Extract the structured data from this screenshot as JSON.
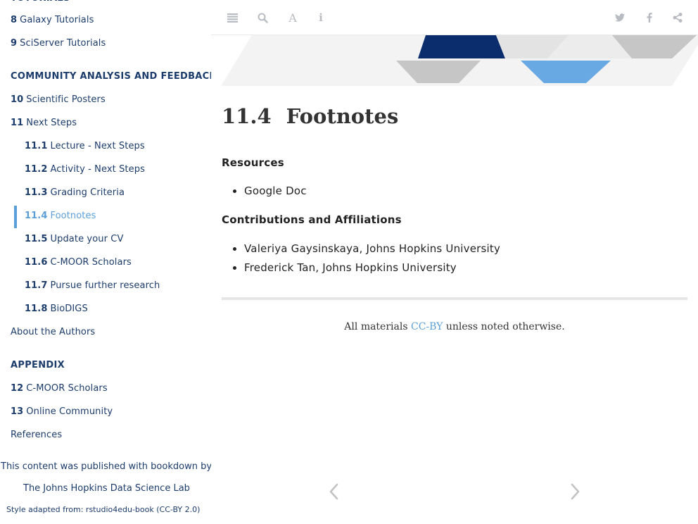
{
  "sidebar": {
    "top_partial_header": "TUTORIALS",
    "items_top": [
      {
        "num": "8",
        "label": "Galaxy Tutorials"
      },
      {
        "num": "9",
        "label": "SciServer Tutorials"
      }
    ],
    "section_community": "COMMUNITY ANALYSIS AND FEEDBACK",
    "items_community": [
      {
        "num": "10",
        "label": "Scientific Posters"
      },
      {
        "num": "11",
        "label": "Next Steps"
      }
    ],
    "subitems": [
      {
        "num": "11.1",
        "label": "Lecture - Next Steps"
      },
      {
        "num": "11.2",
        "label": "Activity - Next Steps"
      },
      {
        "num": "11.3",
        "label": "Grading Criteria"
      },
      {
        "num": "11.4",
        "label": "Footnotes"
      },
      {
        "num": "11.5",
        "label": "Update your CV"
      },
      {
        "num": "11.6",
        "label": "C-MOOR Scholars"
      },
      {
        "num": "11.7",
        "label": "Pursue further research"
      },
      {
        "num": "11.8",
        "label": "BioDIGS"
      }
    ],
    "about_authors": "About the Authors",
    "section_appendix": "APPENDIX",
    "items_appendix": [
      {
        "num": "12",
        "label": "C-MOOR Scholars"
      },
      {
        "num": "13",
        "label": "Online Community"
      }
    ],
    "references": "References",
    "published_with": "This content was published with bookdown by:",
    "publisher": "The Johns Hopkins Data Science Lab",
    "style_adapted": "Style adapted from: rstudio4edu-book (CC-BY 2.0)"
  },
  "toolbar": {
    "left_icons": [
      "sidebar-toggle-icon",
      "search-icon",
      "font-settings-icon",
      "info-icon"
    ],
    "right_icons": [
      "twitter-icon",
      "facebook-icon",
      "share-icon"
    ]
  },
  "content": {
    "title_number": "11.4",
    "title_text": "Footnotes",
    "resources_heading": "Resources",
    "resources": [
      "Google Doc"
    ],
    "contrib_heading": "Contributions and Affiliations",
    "contributors": [
      "Valeriya Gaysinskaya, Johns Hopkins University",
      "Frederick Tan, Johns Hopkins University"
    ],
    "footer_prefix": "All materials ",
    "footer_link": "CC-BY",
    "footer_suffix": " unless noted otherwise."
  },
  "colors": {
    "navy": "#1c3c6c",
    "accent": "#5c9fd8",
    "banner_dark": "#0b2d6e",
    "banner_light": "#69a9e3",
    "banner_gray": "#c6c6c6"
  }
}
